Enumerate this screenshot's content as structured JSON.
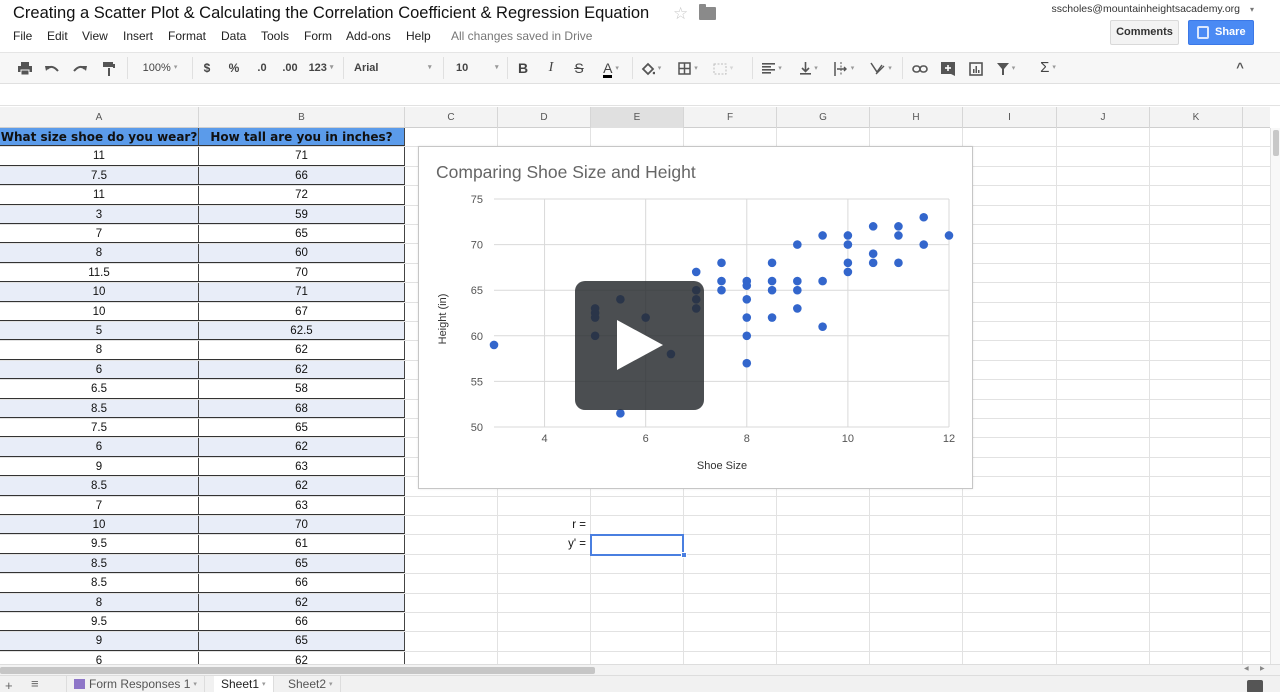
{
  "titlebar": {
    "doc_title": "Creating a Scatter Plot & Calculating the Correlation Coefficient & Regression Equation",
    "account": "sscholes@mountainheightsacademy.org",
    "comments_label": "Comments",
    "share_label": "Share"
  },
  "menu": {
    "items": [
      "File",
      "Edit",
      "View",
      "Insert",
      "Format",
      "Data",
      "Tools",
      "Form",
      "Add-ons",
      "Help"
    ],
    "save_status": "All changes saved in Drive"
  },
  "toolbar": {
    "zoom": "100%",
    "currency": "$",
    "percent": "%",
    "decrease_decimals": ".0",
    "increase_decimals": ".00",
    "more_formats": "123",
    "font": "Arial",
    "font_size": "10",
    "bold": "B",
    "italic": "I",
    "strikethrough": "S",
    "text_color": "A",
    "text_color_value": "#000000"
  },
  "grid": {
    "columns": [
      "A",
      "B",
      "C",
      "D",
      "E",
      "F",
      "G",
      "H",
      "I",
      "J",
      "K"
    ],
    "selected_column": "E",
    "headers": [
      "What size shoe do you wear?",
      "How tall are you in inches?"
    ],
    "rows": [
      [
        "11",
        "71"
      ],
      [
        "7.5",
        "66"
      ],
      [
        "11",
        "72"
      ],
      [
        "3",
        "59"
      ],
      [
        "7",
        "65"
      ],
      [
        "8",
        "60"
      ],
      [
        "11.5",
        "70"
      ],
      [
        "10",
        "71"
      ],
      [
        "10",
        "67"
      ],
      [
        "5",
        "62.5"
      ],
      [
        "8",
        "62"
      ],
      [
        "6",
        "62"
      ],
      [
        "6.5",
        "58"
      ],
      [
        "8.5",
        "68"
      ],
      [
        "7.5",
        "65"
      ],
      [
        "6",
        "62"
      ],
      [
        "9",
        "63"
      ],
      [
        "8.5",
        "62"
      ],
      [
        "7",
        "63"
      ],
      [
        "10",
        "70"
      ],
      [
        "9.5",
        "61"
      ],
      [
        "8.5",
        "65"
      ],
      [
        "8.5",
        "66"
      ],
      [
        "8",
        "62"
      ],
      [
        "9.5",
        "66"
      ],
      [
        "9",
        "65"
      ],
      [
        "6",
        "62"
      ]
    ],
    "r_label": "r =",
    "y_label": "y' =",
    "header_color": "#5b9bea",
    "band_color": "#e8edf8"
  },
  "chart_data": {
    "type": "scatter",
    "title": "Comparing Shoe Size and Height",
    "xlabel": "Shoe Size",
    "ylabel": "Height (in)",
    "xlim": [
      3,
      12
    ],
    "ylim": [
      50,
      75
    ],
    "xticks": [
      "4",
      "6",
      "8",
      "10",
      "12"
    ],
    "yticks": [
      "50",
      "55",
      "60",
      "65",
      "70",
      "75"
    ],
    "grid": true,
    "legend": "none",
    "point_color": "#3366cc",
    "points": [
      [
        3,
        59
      ],
      [
        5,
        63
      ],
      [
        5,
        62.5
      ],
      [
        5,
        62
      ],
      [
        5,
        60
      ],
      [
        5.5,
        64
      ],
      [
        5.5,
        51.5
      ],
      [
        6,
        62
      ],
      [
        6.5,
        58
      ],
      [
        7,
        67
      ],
      [
        7,
        65
      ],
      [
        7,
        64
      ],
      [
        7,
        63
      ],
      [
        7.5,
        68
      ],
      [
        7.5,
        66
      ],
      [
        7.5,
        65
      ],
      [
        8,
        66
      ],
      [
        8,
        65.5
      ],
      [
        8,
        64
      ],
      [
        8,
        62
      ],
      [
        8,
        60
      ],
      [
        8,
        57
      ],
      [
        8.5,
        68
      ],
      [
        8.5,
        66
      ],
      [
        8.5,
        65
      ],
      [
        8.5,
        62
      ],
      [
        9,
        70
      ],
      [
        9,
        66
      ],
      [
        9,
        65
      ],
      [
        9,
        63
      ],
      [
        9.5,
        71
      ],
      [
        9.5,
        66
      ],
      [
        9.5,
        61
      ],
      [
        10,
        71
      ],
      [
        10,
        70
      ],
      [
        10,
        68
      ],
      [
        10,
        67
      ],
      [
        10.5,
        72
      ],
      [
        10.5,
        69
      ],
      [
        10.5,
        68
      ],
      [
        11,
        72
      ],
      [
        11,
        71
      ],
      [
        11,
        68
      ],
      [
        11.5,
        73
      ],
      [
        11.5,
        70
      ],
      [
        12,
        71
      ]
    ]
  },
  "sheets": {
    "tabs": [
      "Form Responses 1",
      "Sheet1",
      "Sheet2"
    ],
    "active": "Sheet1"
  },
  "icons": {
    "star": "☆",
    "caret": "▾",
    "collapse": "^",
    "add_sheet": "+",
    "all_sheets": "≡",
    "sum": "Σ"
  }
}
